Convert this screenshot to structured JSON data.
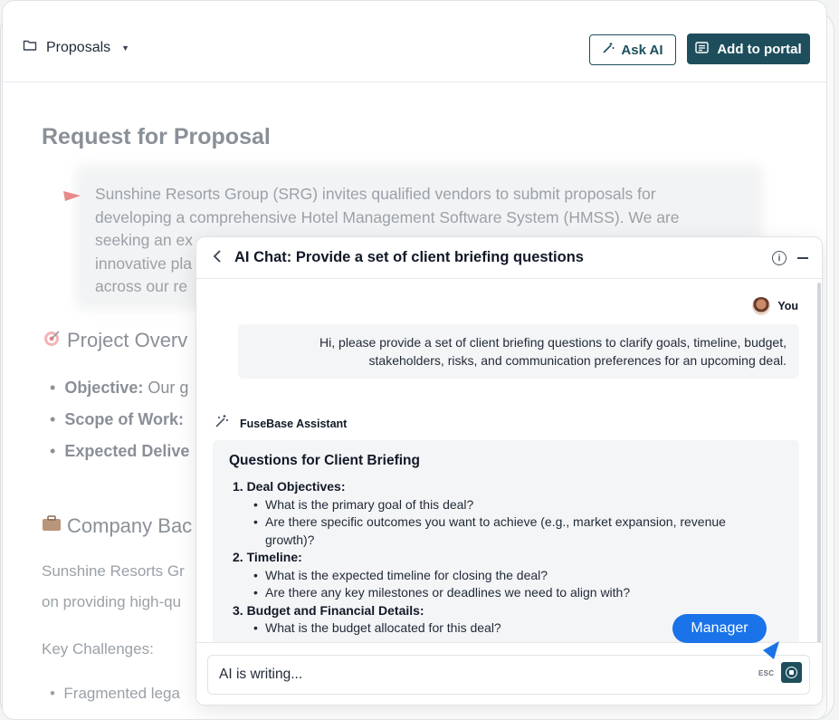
{
  "header": {
    "folder_label": "Proposals",
    "ask_ai_label": "Ask AI",
    "add_portal_label": "Add to portal"
  },
  "document": {
    "title": "Request for Proposal",
    "callout_lines": [
      "Sunshine Resorts Group (SRG) invites qualified vendors to submit proposals for",
      "developing a comprehensive Hotel Management Software System (HMSS). We are",
      "seeking an ex",
      "innovative pla",
      "across our re"
    ],
    "project_overview_heading": "Project Overv",
    "bullets": [
      {
        "label": "Objective:",
        "text": " Our g"
      },
      {
        "label": "Scope of Work:",
        "text": ""
      },
      {
        "label": "Expected Delive",
        "text": ""
      }
    ],
    "company_heading": "Company Bac",
    "company_paragraph_lines": [
      "Sunshine Resorts Gr",
      "on providing high-qu"
    ],
    "key_challenges": "Key Challenges:",
    "challenge_item": "Fragmented lega"
  },
  "chat": {
    "title": "AI Chat: Provide a set of client briefing questions",
    "user_name": "You",
    "user_message_lines": [
      "Hi, please provide a set of client briefing questions to clarify goals, timeline, budget,",
      "stakeholders, risks, and communication preferences for an upcoming deal."
    ],
    "assistant_name": "FuseBase Assistant",
    "response_heading": "Questions for Client Briefing",
    "sections": [
      {
        "title": "1. Deal Objectives:",
        "items": [
          {
            "text": "What is the primary goal of this deal?"
          },
          {
            "text": "Are there specific outcomes you want to achieve (e.g., market expansion, revenue",
            "cont": "growth)?"
          }
        ]
      },
      {
        "title": "2. Timeline:",
        "items": [
          {
            "text": "What is the expected timeline for closing the deal?"
          },
          {
            "text": "Are there any key milestones or deadlines we need to align with?"
          }
        ]
      },
      {
        "title": "3. Budget and Financial Details:",
        "items": [
          {
            "text": "What is the budget allocated for this deal?"
          }
        ]
      }
    ],
    "input_value": "AI is writing...",
    "esc_label": "ESC",
    "cursor_badge": "Manager"
  },
  "colors": {
    "brand": "#1e4e5c",
    "badge": "#1a73e8"
  }
}
